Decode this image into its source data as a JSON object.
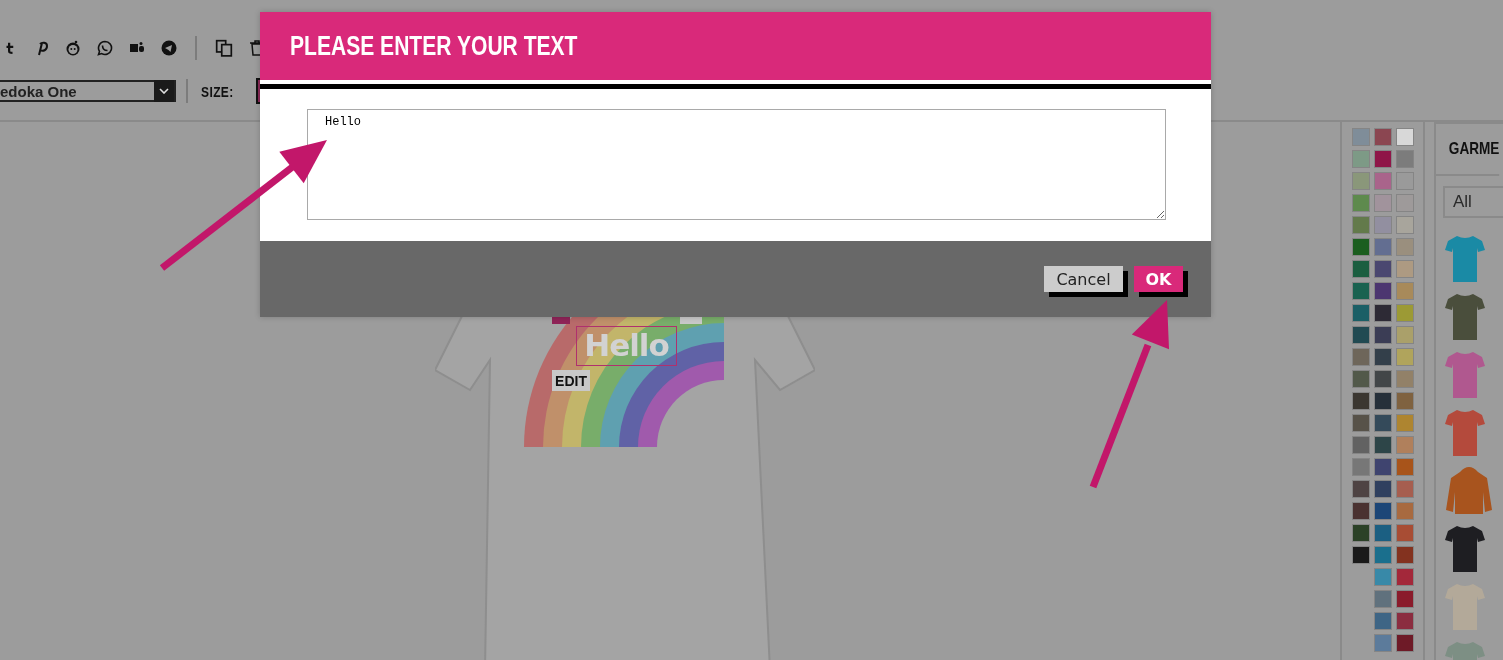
{
  "toolbar": {
    "font_select": {
      "value": "edoka One"
    },
    "size_label": "SIZE:"
  },
  "design": {
    "text": "Hello",
    "edit_button": "EDIT"
  },
  "palette": {
    "columns": [
      [
        {
          "color": "#7f8d99"
        },
        {
          "color": "#7d9a86"
        },
        {
          "color": "#8a977a"
        },
        {
          "color": "#5e8a4d"
        },
        {
          "color": "#637a4b"
        },
        {
          "color": "#1b5e1f"
        },
        {
          "color": "#1b5e40"
        },
        {
          "color": "#1a6250"
        },
        {
          "color": "#1b5f66"
        },
        {
          "color": "#214a52"
        },
        {
          "color": "#6e665a"
        },
        {
          "color": "#52594a"
        },
        {
          "color": "#3b3731"
        },
        {
          "color": "#575249"
        },
        {
          "color": "#626262"
        },
        {
          "color": "#777777"
        },
        {
          "color": "#4e4343"
        },
        {
          "color": "#4a3231"
        },
        {
          "color": "#2b4127"
        },
        {
          "color": "#1a1a1a"
        }
      ],
      [
        {
          "color": "#8b4651"
        },
        {
          "color": "#8f1548"
        },
        {
          "color": "#a9648b"
        },
        {
          "color": "#a1939c"
        },
        {
          "color": "#928fa0"
        },
        {
          "color": "#636e91"
        },
        {
          "color": "#4a4770"
        },
        {
          "color": "#4c3670"
        },
        {
          "color": "#2d2a35"
        },
        {
          "color": "#3b3d55"
        },
        {
          "color": "#333f4a"
        },
        {
          "color": "#424648"
        },
        {
          "color": "#26303a"
        },
        {
          "color": "#344a5a"
        },
        {
          "color": "#2d4548"
        },
        {
          "color": "#3f446f"
        },
        {
          "color": "#30405f"
        },
        {
          "color": "#1c4677"
        },
        {
          "color": "#1b5f82"
        },
        {
          "color": "#1a6f8d"
        },
        {
          "color": "#3889a8"
        },
        {
          "color": "#60717d"
        },
        {
          "color": "#3e6585"
        },
        {
          "color": "#5c7b9b"
        }
      ],
      [
        {
          "color": "#d8d8d8"
        },
        {
          "color": "#7c7c7c"
        },
        {
          "color": "#9a9a9a"
        },
        {
          "color": "#9e9a9a"
        },
        {
          "color": "#a8a59c"
        },
        {
          "color": "#9a8f7e"
        },
        {
          "color": "#ad9a82"
        },
        {
          "color": "#a88a5a"
        },
        {
          "color": "#9c9a35"
        },
        {
          "color": "#aaa06a"
        },
        {
          "color": "#b0a45c"
        },
        {
          "color": "#928168"
        },
        {
          "color": "#7f6240"
        },
        {
          "color": "#ae8530"
        },
        {
          "color": "#b0805c"
        },
        {
          "color": "#a8541a"
        },
        {
          "color": "#a65e4f"
        },
        {
          "color": "#a86a40"
        },
        {
          "color": "#a84d34"
        },
        {
          "color": "#83321f"
        },
        {
          "color": "#a3283a"
        },
        {
          "color": "#8a1b2b"
        },
        {
          "color": "#8b2d40"
        },
        {
          "color": "#6e1a27"
        }
      ]
    ]
  },
  "garments": {
    "heading": "GARME",
    "filter": {
      "value": "All"
    },
    "items": [
      {
        "kind": "tee",
        "color": "#1a8aa5"
      },
      {
        "kind": "tee",
        "color": "#4a4e3c"
      },
      {
        "kind": "tee",
        "color": "#b0588f"
      },
      {
        "kind": "tee",
        "color": "#b44a3c"
      },
      {
        "kind": "hoodie",
        "color": "#a8541e"
      },
      {
        "kind": "tee",
        "color": "#1e1e22"
      },
      {
        "kind": "tee",
        "color": "#b3a999"
      },
      {
        "kind": "tee",
        "color": "#7d8f84"
      }
    ]
  },
  "dialog": {
    "title": "PLEASE ENTER YOUR TEXT",
    "textarea": {
      "value": "Hello"
    },
    "buttons": [
      {
        "label": "Cancel",
        "kind": "secondary"
      },
      {
        "label": "OK",
        "kind": "primary"
      }
    ]
  }
}
